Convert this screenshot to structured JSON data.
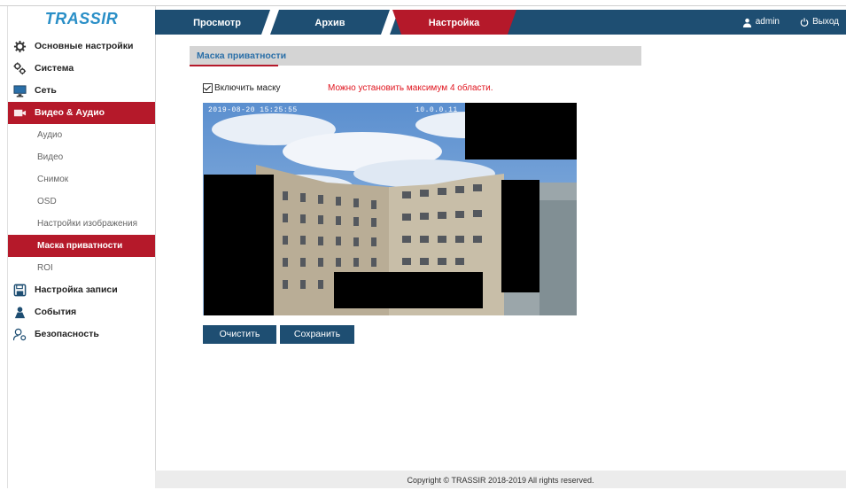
{
  "brand": {
    "logo_text": "TRASSIR"
  },
  "nav": {
    "tabs": [
      {
        "label": "Просмотр"
      },
      {
        "label": "Архив"
      },
      {
        "label": "Настройка"
      }
    ],
    "user": "admin",
    "logout": "Выход"
  },
  "sidebar": {
    "items": [
      {
        "label": "Основные настройки"
      },
      {
        "label": "Система"
      },
      {
        "label": "Сеть"
      },
      {
        "label": "Видео & Аудио"
      },
      {
        "label": "Настройка записи"
      },
      {
        "label": "События"
      },
      {
        "label": "Безопасность"
      }
    ],
    "subitems": [
      {
        "label": "Аудио"
      },
      {
        "label": "Видео"
      },
      {
        "label": "Снимок"
      },
      {
        "label": "OSD"
      },
      {
        "label": "Настройки изображения"
      },
      {
        "label": "Маска приватности"
      },
      {
        "label": "ROI"
      }
    ]
  },
  "main": {
    "section_title": "Маска приватности",
    "enable_mask_label": "Включить маску",
    "enable_mask_checked": true,
    "warning": "Можно установить максимум 4 области.",
    "video": {
      "osd_datetime": "2019-08-20 15:25:55",
      "osd_ip": "10.0.0.11"
    },
    "clear_button": "Очистить",
    "save_button": "Сохранить"
  },
  "footer": {
    "copyright": "Copyright © TRASSIR 2018-2019 All rights reserved."
  },
  "colors": {
    "accent": "#b5192a",
    "nav_bg": "#1e4e72",
    "link_blue": "#2a6fa8",
    "warning": "#e0141e"
  }
}
